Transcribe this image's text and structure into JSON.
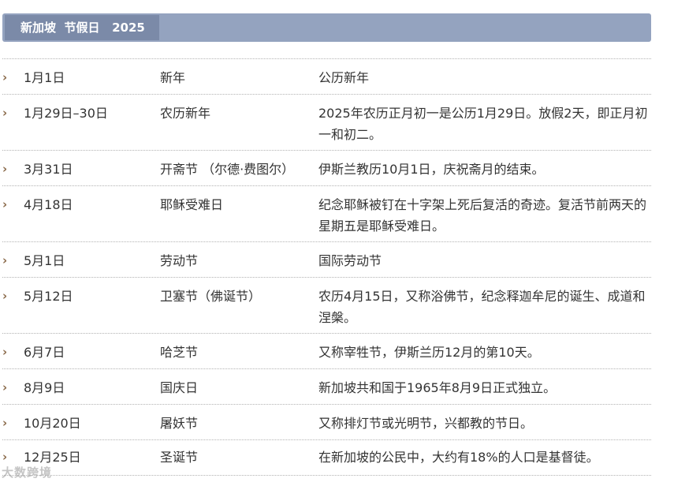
{
  "header": {
    "title": "新加坡  节假日   2025"
  },
  "holidays": [
    {
      "date": "1月1日",
      "name": "新年",
      "desc": "公历新年"
    },
    {
      "date": "1月29日–30日",
      "name": "农历新年",
      "desc": "2025年农历正月初一是公历1月29日。放假2天，即正月初一和初二。"
    },
    {
      "date": "3月31日",
      "name": "开斋节 （尔德·费图尔）",
      "desc": "伊斯兰教历10月1日，庆祝斋月的结束。"
    },
    {
      "date": "4月18日",
      "name": "耶稣受难日",
      "desc": "纪念耶稣被钉在十字架上死后复活的奇迹。复活节前两天的星期五是耶稣受难日。"
    },
    {
      "date": "5月1日",
      "name": "劳动节",
      "desc": "国际劳动节"
    },
    {
      "date": "5月12日",
      "name": "卫塞节（佛诞节）",
      "desc": "农历4月15日，又称浴佛节，纪念释迦牟尼的诞生、成道和涅槃。"
    },
    {
      "date": "6月7日",
      "name": "哈芝节",
      "desc": "又称宰牲节，伊斯兰历12月的第10天。"
    },
    {
      "date": "8月9日",
      "name": "国庆日",
      "desc": "新加坡共和国于1965年8月9日正式独立。"
    },
    {
      "date": "10月20日",
      "name": "屠妖节",
      "desc": "又称排灯节或光明节，兴都教的节日。"
    },
    {
      "date": "12月25日",
      "name": "圣诞节",
      "desc": "在新加坡的公民中，大约有18%的人口是基督徒。"
    }
  ],
  "watermark": "大数跨境",
  "icons": {
    "row_marker": "chevron-right-icon"
  },
  "colors": {
    "header_bar": "#94a3bf",
    "title_tab": "#7b8aa8",
    "chevron": "#8a6a4a"
  }
}
